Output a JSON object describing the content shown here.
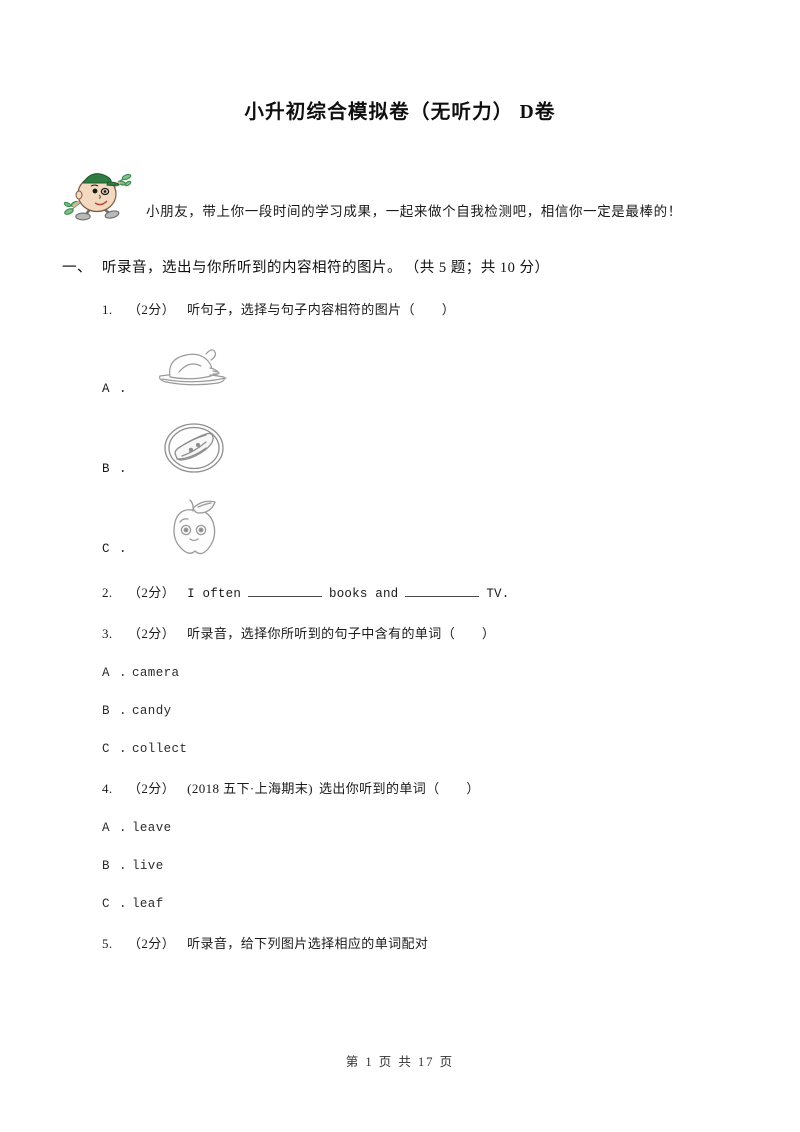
{
  "document": {
    "title": "小升初综合模拟卷（无听力） D卷",
    "intro": {
      "mascot_icon": "cartoon-boy-with-green-cap-icon",
      "text": "小朋友，带上你一段时间的学习成果，一起来做个自我检测吧，相信你一定是最棒的！"
    },
    "footer": "第 1 页 共 17 页"
  },
  "section": {
    "number": "一、",
    "title": "听录音，选出与你所听到的内容相符的图片。",
    "score": "（共 5 题；共 10 分）"
  },
  "questions": [
    {
      "index": "1.",
      "points": "（2分）",
      "text": "听句子，选择与句子内容相符的图片（　　）",
      "options": [
        {
          "letter": "A .",
          "image": "roast-turkey-on-plate-image"
        },
        {
          "letter": "B .",
          "image": "cake-slice-on-plate-image"
        },
        {
          "letter": "C .",
          "image": "cartoon-apple-with-face-image"
        }
      ]
    },
    {
      "index": "2.",
      "points": "（2分）",
      "text_parts": {
        "before": "I often",
        "middle": "books and",
        "after": "TV."
      }
    },
    {
      "index": "3.",
      "points": "（2分）",
      "text": "听录音，选择你所听到的句子中含有的单词（　　）",
      "options": [
        {
          "letter": "A .",
          "label": "camera"
        },
        {
          "letter": "B .",
          "label": "candy"
        },
        {
          "letter": "C .",
          "label": "collect"
        }
      ]
    },
    {
      "index": "4.",
      "points": "（2分）",
      "tag": "(2018 五下·上海期末)",
      "text": "选出你听到的单词（　　）",
      "options": [
        {
          "letter": "A .",
          "label": "leave"
        },
        {
          "letter": "B .",
          "label": "live"
        },
        {
          "letter": "C .",
          "label": "leaf"
        }
      ]
    },
    {
      "index": "5.",
      "points": "（2分）",
      "text": "听录音，给下列图片选择相应的单词配对"
    }
  ],
  "colors": {
    "page_background": "#ffffff",
    "text": "#1a1a1a",
    "line_art": "#8a8a8a",
    "mascot_cap": "#2f7d42",
    "mascot_skin": "#f3d9c0",
    "mascot_leaf": "#3b8a4e",
    "mascot_shoe": "#9a9a9a"
  }
}
